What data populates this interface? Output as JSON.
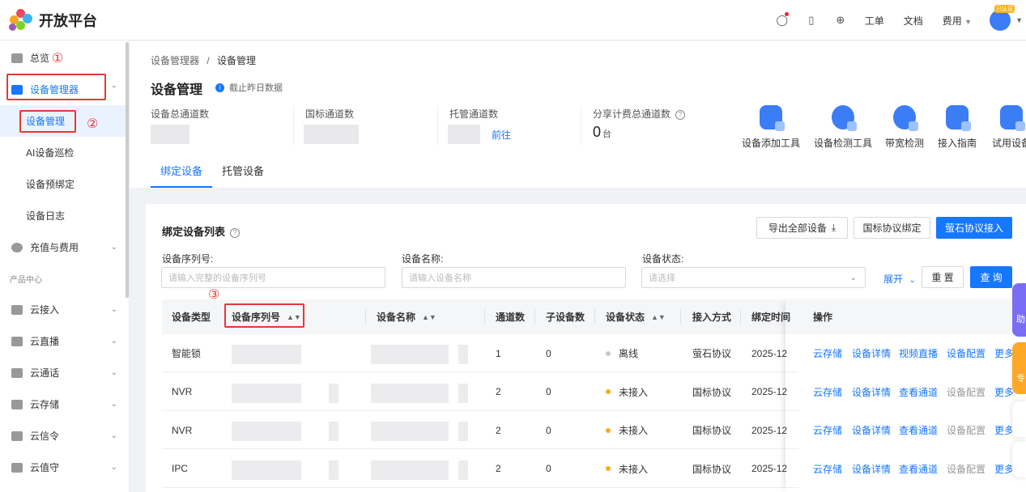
{
  "header": {
    "app_name": "开放平台",
    "links": [
      "工单",
      "文档"
    ],
    "fee_label": "费用",
    "avatar_badge": "已认证"
  },
  "sidebar": {
    "overview": "总览",
    "device_manager": "设备管理器",
    "sub_items": [
      "设备管理",
      "AI设备巡检",
      "设备预绑定",
      "设备日志"
    ],
    "billing": "充值与费用",
    "group_label": "产品中心",
    "products": [
      "云接入",
      "云直播",
      "云通话",
      "云存储",
      "云信令",
      "云值守"
    ]
  },
  "annotations": [
    "①",
    "②",
    "③"
  ],
  "breadcrumb": {
    "parent": "设备管理器",
    "sep": "/",
    "current": "设备管理"
  },
  "page": {
    "title": "设备管理",
    "note": "截止昨日数据"
  },
  "stats": [
    {
      "label": "设备总通道数"
    },
    {
      "label": "国标通道数"
    },
    {
      "label": "托管通道数",
      "link": "前往"
    },
    {
      "label": "分享计费总通道数",
      "value": "0",
      "unit": "台"
    }
  ],
  "tools": [
    "设备添加工具",
    "设备检测工具",
    "带宽检测",
    "接入指南",
    "试用设备"
  ],
  "tabs": [
    "绑定设备",
    "托管设备"
  ],
  "list": {
    "title": "绑定设备列表",
    "buttons": {
      "export": "导出全部设备",
      "gb_bind": "国标协议绑定",
      "ys_access": "萤石协议接入"
    },
    "filters": [
      {
        "label": "设备序列号:",
        "placeholder": "请输入完整的设备序列号"
      },
      {
        "label": "设备名称:",
        "placeholder": "请输入设备名称"
      },
      {
        "label": "设备状态:",
        "placeholder": "请选择"
      }
    ],
    "expand": "展开",
    "reset": "重 置",
    "query": "查 询"
  },
  "table": {
    "columns": [
      "设备类型",
      "设备序列号",
      "设备名称",
      "通道数",
      "子设备数",
      "设备状态",
      "接入方式",
      "绑定时间",
      "操作"
    ],
    "rows": [
      {
        "type": "智能锁",
        "channels": "1",
        "sub": "0",
        "status": "离线",
        "status_color": "#c8c8c8",
        "access": "萤石协议",
        "time": "2025-12",
        "ops": [
          "云存储",
          "设备详情",
          "视频直播",
          "设备配置",
          "更多"
        ],
        "disabled": []
      },
      {
        "type": "NVR",
        "channels": "2",
        "sub": "0",
        "status": "未接入",
        "status_color": "#faad14",
        "access": "国标协议",
        "time": "2025-12",
        "ops": [
          "云存储",
          "设备详情",
          "查看通道",
          "设备配置",
          "更多"
        ],
        "disabled": [
          3
        ]
      },
      {
        "type": "NVR",
        "channels": "2",
        "sub": "0",
        "status": "未接入",
        "status_color": "#faad14",
        "access": "国标协议",
        "time": "2025-12",
        "ops": [
          "云存储",
          "设备详情",
          "查看通道",
          "设备配置",
          "更多"
        ],
        "disabled": [
          3
        ]
      },
      {
        "type": "IPC",
        "channels": "2",
        "sub": "0",
        "status": "未接入",
        "status_color": "#faad14",
        "access": "国标协议",
        "time": "2025-12",
        "ops": [
          "云存储",
          "设备详情",
          "查看通道",
          "设备配置",
          "更多"
        ],
        "disabled": [
          3
        ]
      }
    ]
  },
  "float_widgets": [
    "助",
    "专"
  ],
  "colors": {
    "primary": "#1677ff",
    "annotation": "#e53935",
    "warning": "#faad14"
  }
}
